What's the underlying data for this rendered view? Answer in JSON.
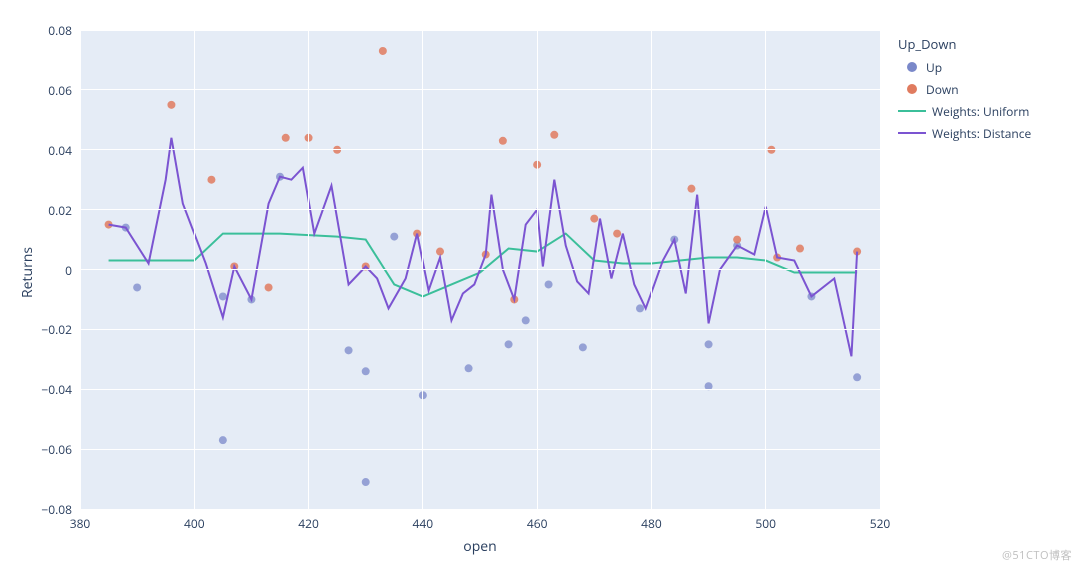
{
  "chart_data": {
    "type": "scatter",
    "xlabel": "open",
    "ylabel": "Returns",
    "xlim": [
      380,
      520
    ],
    "ylim": [
      -0.08,
      0.08
    ],
    "x_ticks": [
      380,
      400,
      420,
      440,
      460,
      480,
      500,
      520
    ],
    "y_ticks": [
      -0.08,
      -0.06,
      -0.04,
      -0.02,
      0,
      0.02,
      0.04,
      0.06,
      0.08
    ],
    "y_tick_labels": [
      "−0.08",
      "−0.06",
      "−0.04",
      "−0.02",
      "0",
      "0.02",
      "0.04",
      "0.06",
      "0.08"
    ],
    "legend_title": "Up_Down",
    "series": [
      {
        "name": "Up",
        "render": "scatter",
        "color": "#7a88c9",
        "points": [
          {
            "x": 388,
            "y": 0.014
          },
          {
            "x": 390,
            "y": -0.006
          },
          {
            "x": 405,
            "y": -0.009
          },
          {
            "x": 405,
            "y": -0.057
          },
          {
            "x": 410,
            "y": -0.01
          },
          {
            "x": 415,
            "y": 0.031
          },
          {
            "x": 427,
            "y": -0.027
          },
          {
            "x": 430,
            "y": -0.034
          },
          {
            "x": 430,
            "y": -0.071
          },
          {
            "x": 435,
            "y": 0.011
          },
          {
            "x": 440,
            "y": -0.042
          },
          {
            "x": 448,
            "y": -0.033
          },
          {
            "x": 455,
            "y": -0.025
          },
          {
            "x": 458,
            "y": -0.017
          },
          {
            "x": 462,
            "y": -0.005
          },
          {
            "x": 468,
            "y": -0.026
          },
          {
            "x": 478,
            "y": -0.013
          },
          {
            "x": 484,
            "y": 0.01
          },
          {
            "x": 490,
            "y": -0.039
          },
          {
            "x": 490,
            "y": -0.025
          },
          {
            "x": 495,
            "y": 0.008
          },
          {
            "x": 508,
            "y": -0.009
          },
          {
            "x": 516,
            "y": -0.036
          }
        ]
      },
      {
        "name": "Down",
        "render": "scatter",
        "color": "#e07b5f",
        "points": [
          {
            "x": 385,
            "y": 0.015
          },
          {
            "x": 396,
            "y": 0.055
          },
          {
            "x": 403,
            "y": 0.03
          },
          {
            "x": 407,
            "y": 0.001
          },
          {
            "x": 413,
            "y": -0.006
          },
          {
            "x": 416,
            "y": 0.044
          },
          {
            "x": 420,
            "y": 0.044
          },
          {
            "x": 425,
            "y": 0.04
          },
          {
            "x": 430,
            "y": 0.001
          },
          {
            "x": 433,
            "y": 0.073
          },
          {
            "x": 439,
            "y": 0.012
          },
          {
            "x": 443,
            "y": 0.006
          },
          {
            "x": 451,
            "y": 0.005
          },
          {
            "x": 454,
            "y": 0.043
          },
          {
            "x": 456,
            "y": -0.01
          },
          {
            "x": 460,
            "y": 0.035
          },
          {
            "x": 463,
            "y": 0.045
          },
          {
            "x": 470,
            "y": 0.017
          },
          {
            "x": 474,
            "y": 0.012
          },
          {
            "x": 487,
            "y": 0.027
          },
          {
            "x": 495,
            "y": 0.01
          },
          {
            "x": 501,
            "y": 0.04
          },
          {
            "x": 502,
            "y": 0.004
          },
          {
            "x": 506,
            "y": 0.007
          },
          {
            "x": 516,
            "y": 0.006
          }
        ]
      },
      {
        "name": "Weights: Uniform",
        "render": "line",
        "color": "#3bbf9a",
        "points": [
          {
            "x": 385,
            "y": 0.003
          },
          {
            "x": 395,
            "y": 0.003
          },
          {
            "x": 400,
            "y": 0.003
          },
          {
            "x": 405,
            "y": 0.012
          },
          {
            "x": 415,
            "y": 0.012
          },
          {
            "x": 425,
            "y": 0.011
          },
          {
            "x": 430,
            "y": 0.01
          },
          {
            "x": 435,
            "y": -0.005
          },
          {
            "x": 440,
            "y": -0.009
          },
          {
            "x": 445,
            "y": -0.005
          },
          {
            "x": 450,
            "y": -0.001
          },
          {
            "x": 455,
            "y": 0.007
          },
          {
            "x": 460,
            "y": 0.006
          },
          {
            "x": 465,
            "y": 0.012
          },
          {
            "x": 470,
            "y": 0.003
          },
          {
            "x": 475,
            "y": 0.002
          },
          {
            "x": 480,
            "y": 0.002
          },
          {
            "x": 485,
            "y": 0.003
          },
          {
            "x": 490,
            "y": 0.004
          },
          {
            "x": 495,
            "y": 0.004
          },
          {
            "x": 500,
            "y": 0.003
          },
          {
            "x": 505,
            "y": -0.001
          },
          {
            "x": 510,
            "y": -0.001
          },
          {
            "x": 516,
            "y": -0.001
          }
        ]
      },
      {
        "name": "Weights: Distance",
        "render": "line",
        "color": "#7b54d1",
        "points": [
          {
            "x": 385,
            "y": 0.015
          },
          {
            "x": 388,
            "y": 0.014
          },
          {
            "x": 392,
            "y": 0.002
          },
          {
            "x": 395,
            "y": 0.03
          },
          {
            "x": 396,
            "y": 0.044
          },
          {
            "x": 398,
            "y": 0.022
          },
          {
            "x": 402,
            "y": 0.002
          },
          {
            "x": 405,
            "y": -0.016
          },
          {
            "x": 407,
            "y": 0.001
          },
          {
            "x": 410,
            "y": -0.01
          },
          {
            "x": 413,
            "y": 0.022
          },
          {
            "x": 415,
            "y": 0.031
          },
          {
            "x": 417,
            "y": 0.03
          },
          {
            "x": 419,
            "y": 0.034
          },
          {
            "x": 421,
            "y": 0.012
          },
          {
            "x": 424,
            "y": 0.028
          },
          {
            "x": 427,
            "y": -0.005
          },
          {
            "x": 430,
            "y": 0.001
          },
          {
            "x": 432,
            "y": -0.003
          },
          {
            "x": 434,
            "y": -0.013
          },
          {
            "x": 437,
            "y": -0.003
          },
          {
            "x": 439,
            "y": 0.012
          },
          {
            "x": 441,
            "y": -0.007
          },
          {
            "x": 443,
            "y": 0.004
          },
          {
            "x": 445,
            "y": -0.017
          },
          {
            "x": 447,
            "y": -0.008
          },
          {
            "x": 449,
            "y": -0.005
          },
          {
            "x": 451,
            "y": 0.005
          },
          {
            "x": 452,
            "y": 0.025
          },
          {
            "x": 454,
            "y": 0.0
          },
          {
            "x": 456,
            "y": -0.01
          },
          {
            "x": 458,
            "y": 0.015
          },
          {
            "x": 460,
            "y": 0.02
          },
          {
            "x": 461,
            "y": 0.001
          },
          {
            "x": 463,
            "y": 0.03
          },
          {
            "x": 465,
            "y": 0.008
          },
          {
            "x": 467,
            "y": -0.004
          },
          {
            "x": 469,
            "y": -0.008
          },
          {
            "x": 471,
            "y": 0.017
          },
          {
            "x": 473,
            "y": -0.003
          },
          {
            "x": 475,
            "y": 0.012
          },
          {
            "x": 477,
            "y": -0.005
          },
          {
            "x": 479,
            "y": -0.013
          },
          {
            "x": 482,
            "y": 0.003
          },
          {
            "x": 484,
            "y": 0.01
          },
          {
            "x": 486,
            "y": -0.008
          },
          {
            "x": 488,
            "y": 0.025
          },
          {
            "x": 490,
            "y": -0.018
          },
          {
            "x": 492,
            "y": 0.0
          },
          {
            "x": 495,
            "y": 0.008
          },
          {
            "x": 498,
            "y": 0.005
          },
          {
            "x": 500,
            "y": 0.021
          },
          {
            "x": 502,
            "y": 0.004
          },
          {
            "x": 505,
            "y": 0.003
          },
          {
            "x": 508,
            "y": -0.009
          },
          {
            "x": 512,
            "y": -0.003
          },
          {
            "x": 515,
            "y": -0.029
          },
          {
            "x": 516,
            "y": 0.006
          }
        ]
      }
    ]
  },
  "watermark": "@51CTO博客"
}
